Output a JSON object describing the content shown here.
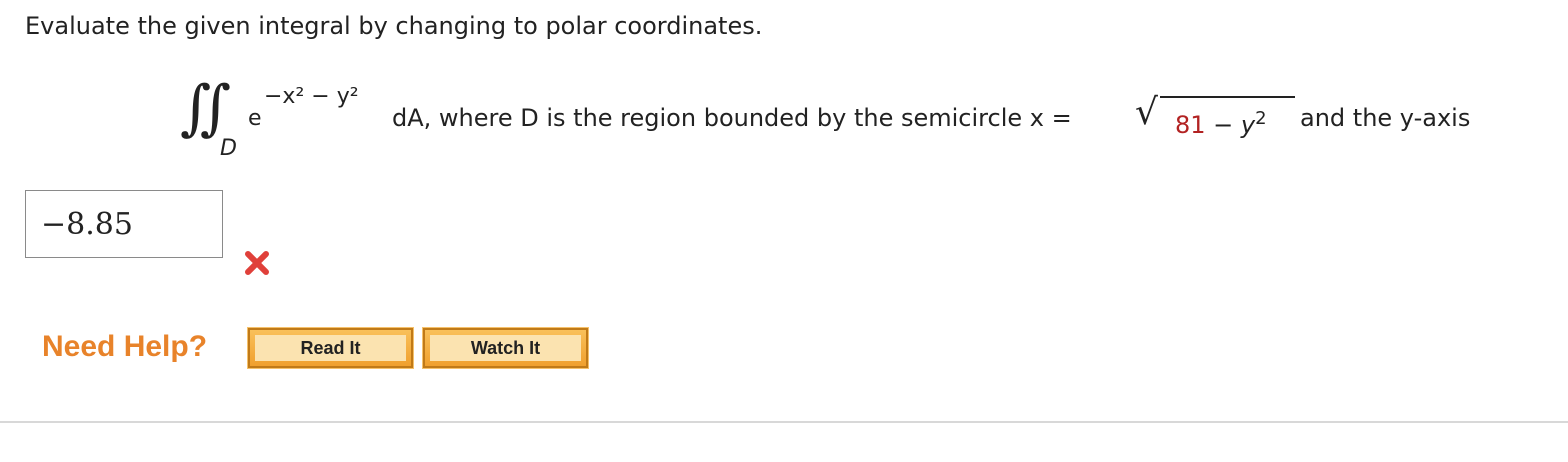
{
  "question": {
    "prompt": "Evaluate the given integral by changing to polar coordinates.",
    "integral_symbol": "∬",
    "region_subscript": "D",
    "base": "e",
    "exponent_text": "−x² − y²",
    "rest_text": "dA, where D is the region bounded by the semicircle x =",
    "radicand_number": "81",
    "radicand_rest": " − y",
    "radicand_power": "2",
    "tail_text": "and the y-axis"
  },
  "answer": {
    "value": "−8.85",
    "status": "incorrect",
    "status_icon": "x-icon",
    "status_color": "#e0403a"
  },
  "help": {
    "label": "Need Help?",
    "read_label": "Read It",
    "watch_label": "Watch It"
  },
  "colors": {
    "accent": "#e8832a",
    "button": "#f0a02e",
    "radicand_highlight": "#b22222"
  }
}
